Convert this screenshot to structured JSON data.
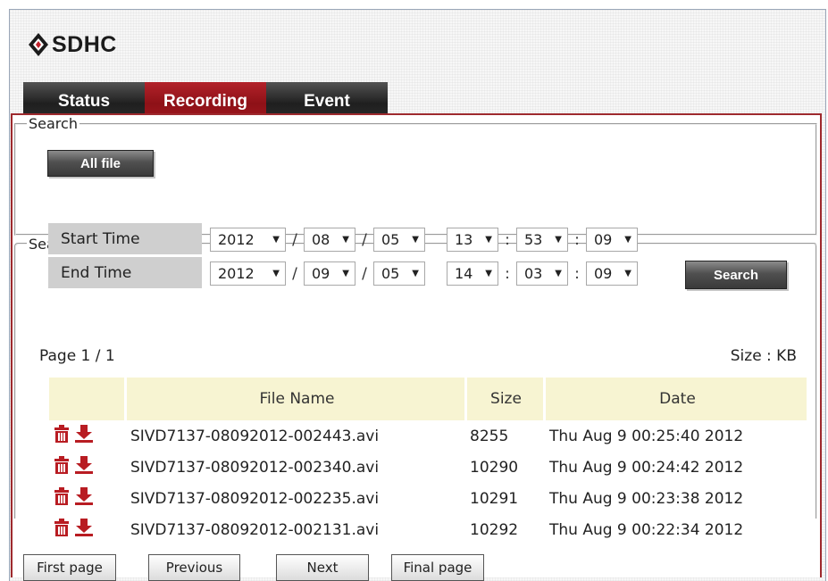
{
  "brand": {
    "name": "SDHC"
  },
  "tabs": [
    {
      "label": "Status",
      "active": false
    },
    {
      "label": "Recording",
      "active": true
    },
    {
      "label": "Event",
      "active": false
    }
  ],
  "all_file_button": "All file",
  "search": {
    "legend": "Search",
    "start": {
      "label": "Start Time",
      "year": "2012",
      "month": "08",
      "day": "05",
      "hour": "13",
      "minute": "53",
      "second": "09"
    },
    "end": {
      "label": "End Time",
      "year": "2012",
      "month": "09",
      "day": "05",
      "hour": "14",
      "minute": "03",
      "second": "09"
    },
    "date_sep": "/",
    "time_sep": ":",
    "button": "Search"
  },
  "result": {
    "legend": "Search Result",
    "page_info": "Page 1 / 1",
    "size_unit": "Size : KB",
    "columns": [
      "",
      "File Name",
      "Size",
      "Date"
    ],
    "rows": [
      {
        "name": "SIVD7137-08092012-002443.avi",
        "size": "8255",
        "date": "Thu Aug 9 00:25:40 2012"
      },
      {
        "name": "SIVD7137-08092012-002340.avi",
        "size": "10290",
        "date": "Thu Aug 9 00:24:42 2012"
      },
      {
        "name": "SIVD7137-08092012-002235.avi",
        "size": "10291",
        "date": "Thu Aug 9 00:23:38 2012"
      },
      {
        "name": "SIVD7137-08092012-002131.avi",
        "size": "10292",
        "date": "Thu Aug 9 00:22:34 2012"
      }
    ],
    "row_icons": [
      "delete-icon",
      "download-icon"
    ]
  },
  "pager": {
    "first": "First page",
    "previous": "Previous",
    "next": "Next",
    "final": "Final page"
  },
  "colors": {
    "accent_red": "#a0181f",
    "tab_dark": "#2c2c2c",
    "header_row": "#f7f4d2",
    "label_bg": "#cfcfcf"
  }
}
